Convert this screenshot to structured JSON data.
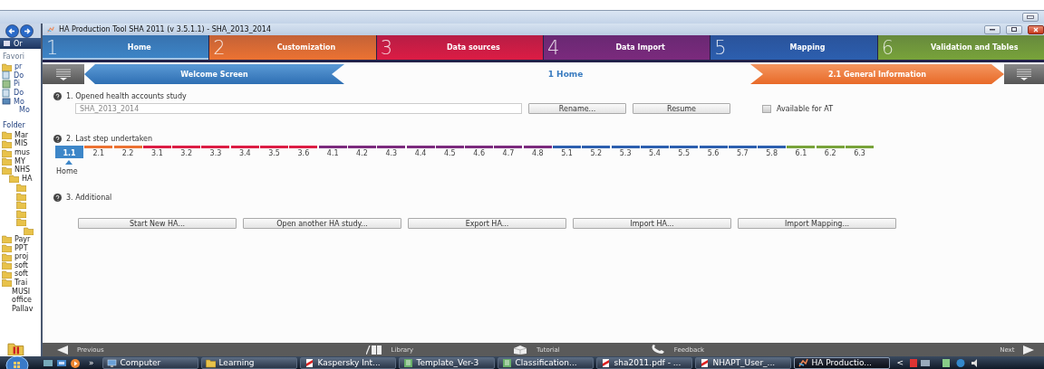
{
  "explorer": {
    "toolbar_label": "Or",
    "favorites_label": "Favori",
    "favorites": [
      {
        "label": "pr",
        "kind": "folder"
      },
      {
        "label": "Do",
        "kind": "library"
      },
      {
        "label": "Pi",
        "kind": "picture"
      },
      {
        "label": "Do",
        "kind": "library"
      },
      {
        "label": "Mo",
        "kind": "video",
        "children": [
          {
            "label": "Mo"
          }
        ]
      }
    ],
    "folders_label": "Folder",
    "folders": [
      {
        "label": "Mar",
        "kind": "folder"
      },
      {
        "label": "MIS",
        "kind": "folder"
      },
      {
        "label": "mus",
        "kind": "folder"
      },
      {
        "label": "MY",
        "kind": "folder"
      },
      {
        "label": "NHS",
        "kind": "folder",
        "children": [
          {
            "label": "HA",
            "kind": "folder",
            "children": [
              {
                "kind": "folder"
              },
              {
                "kind": "folder"
              },
              {
                "kind": "folder"
              },
              {
                "kind": "folder"
              },
              {
                "kind": "folder",
                "children": [
                  {
                    "kind": "folder"
                  }
                ]
              }
            ]
          }
        ]
      },
      {
        "label": "Payr",
        "kind": "folder"
      },
      {
        "label": "PPT",
        "kind": "folder"
      },
      {
        "label": "proj",
        "kind": "folder"
      },
      {
        "label": "soft",
        "kind": "folder"
      },
      {
        "label": "soft",
        "kind": "folder"
      },
      {
        "label": "Trai",
        "kind": "folder"
      },
      {
        "label": "MUSI"
      },
      {
        "label": "office"
      },
      {
        "label": "Pallav"
      }
    ]
  },
  "window": {
    "title": "HA Production Tool SHA 2011 (v 3.5.1.1) - SHA_2013_2014"
  },
  "tabs": [
    {
      "number": "1",
      "label": "Home",
      "color": "#3d86c8",
      "selected": true
    },
    {
      "number": "2",
      "label": "Customization",
      "color": "#ec7232",
      "selected": false
    },
    {
      "number": "3",
      "label": "Data sources",
      "color": "#dc1c44",
      "selected": false
    },
    {
      "number": "4",
      "label": "Data Import",
      "color": "#7b2a7d",
      "selected": false
    },
    {
      "number": "5",
      "label": "Mapping",
      "color": "#2c5faf",
      "selected": false
    },
    {
      "number": "6",
      "label": "Validation and Tables",
      "color": "#78a33a",
      "selected": false
    }
  ],
  "breadcrumb": {
    "previous": "Welcome Screen",
    "current": "1 Home",
    "next": "2.1 General Information"
  },
  "section_opened": {
    "title": "1. Opened health accounts study",
    "study_name": "SHA_2013_2014",
    "buttons": [
      "Rename...",
      "Resume"
    ],
    "available_for_at": {
      "label": "Available for AT",
      "checked": false
    }
  },
  "section_last_step": {
    "title": "2. Last step undertaken",
    "marker_label": "Home",
    "steps": [
      {
        "label": "1.1",
        "color": "#3d86c8",
        "selected": true
      },
      {
        "label": "2.1",
        "color": "#ec7232",
        "selected": false
      },
      {
        "label": "2.2",
        "color": "#ec7232",
        "selected": false
      },
      {
        "label": "3.1",
        "color": "#dc1c44",
        "selected": false
      },
      {
        "label": "3.2",
        "color": "#dc1c44",
        "selected": false
      },
      {
        "label": "3.3",
        "color": "#dc1c44",
        "selected": false
      },
      {
        "label": "3.4",
        "color": "#dc1c44",
        "selected": false
      },
      {
        "label": "3.5",
        "color": "#dc1c44",
        "selected": false
      },
      {
        "label": "3.6",
        "color": "#dc1c44",
        "selected": false
      },
      {
        "label": "4.1",
        "color": "#7b2a7d",
        "selected": false
      },
      {
        "label": "4.2",
        "color": "#7b2a7d",
        "selected": false
      },
      {
        "label": "4.3",
        "color": "#7b2a7d",
        "selected": false
      },
      {
        "label": "4.4",
        "color": "#7b2a7d",
        "selected": false
      },
      {
        "label": "4.5",
        "color": "#7b2a7d",
        "selected": false
      },
      {
        "label": "4.6",
        "color": "#7b2a7d",
        "selected": false
      },
      {
        "label": "4.7",
        "color": "#7b2a7d",
        "selected": false
      },
      {
        "label": "4.8",
        "color": "#7b2a7d",
        "selected": false
      },
      {
        "label": "5.1",
        "color": "#2c5faf",
        "selected": false
      },
      {
        "label": "5.2",
        "color": "#2c5faf",
        "selected": false
      },
      {
        "label": "5.3",
        "color": "#2c5faf",
        "selected": false
      },
      {
        "label": "5.4",
        "color": "#2c5faf",
        "selected": false
      },
      {
        "label": "5.5",
        "color": "#2c5faf",
        "selected": false
      },
      {
        "label": "5.6",
        "color": "#2c5faf",
        "selected": false
      },
      {
        "label": "5.7",
        "color": "#2c5faf",
        "selected": false
      },
      {
        "label": "5.8",
        "color": "#2c5faf",
        "selected": false
      },
      {
        "label": "6.1",
        "color": "#78a33a",
        "selected": false
      },
      {
        "label": "6.2",
        "color": "#78a33a",
        "selected": false
      },
      {
        "label": "6.3",
        "color": "#78a33a",
        "selected": false
      }
    ]
  },
  "section_additional": {
    "title": "3. Additional",
    "buttons": [
      "Start New HA...",
      "Open another HA study...",
      "Export HA...",
      "Import HA...",
      "Import Mapping..."
    ]
  },
  "bottom_bar": [
    {
      "kind": "previous",
      "label": "Previous"
    },
    {
      "kind": "library",
      "label": "Library"
    },
    {
      "kind": "tutorial",
      "label": "Tutorial"
    },
    {
      "kind": "feedback",
      "label": "Feedback"
    },
    {
      "kind": "next",
      "label": "Next"
    }
  ],
  "taskbar": {
    "overflow": "»",
    "scroll": "<",
    "items": [
      {
        "label": "Computer",
        "kind": "computer",
        "selected": false
      },
      {
        "label": "Learning",
        "kind": "folder",
        "selected": false
      },
      {
        "label": "Kaspersky Int...",
        "kind": "pdf",
        "selected": false
      },
      {
        "label": "Template_Ver-3",
        "kind": "sheet",
        "selected": false
      },
      {
        "label": "Classification...",
        "kind": "sheet",
        "selected": false
      },
      {
        "label": "sha2011.pdf - ...",
        "kind": "pdf",
        "selected": false
      },
      {
        "label": "NHAPT_User_...",
        "kind": "pdf",
        "selected": false
      },
      {
        "label": "HA Productio...",
        "kind": "app",
        "selected": true
      }
    ]
  }
}
